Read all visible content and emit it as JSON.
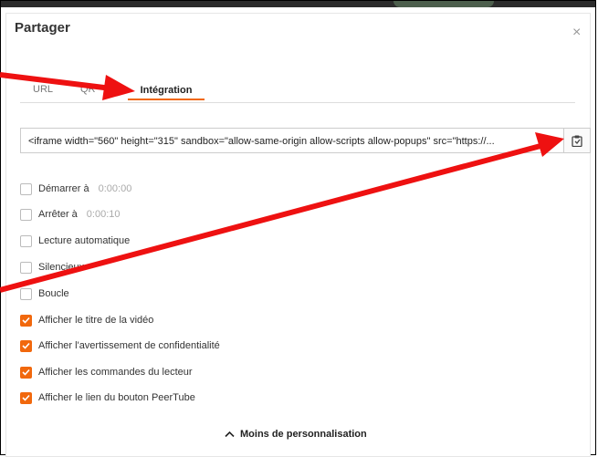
{
  "dialog": {
    "title": "Partager",
    "close_glyph": "×"
  },
  "tabs": [
    {
      "label": "URL"
    },
    {
      "label": "QR"
    },
    {
      "label": "Intégration"
    }
  ],
  "embed": {
    "code": "<iframe width=\"560\" height=\"315\" sandbox=\"allow-same-origin allow-scripts allow-popups\" src=\"https://...",
    "copy_icon": "clipboard-icon"
  },
  "options": [
    {
      "label": "Démarrer à",
      "time": "0:00:00",
      "checked": false
    },
    {
      "label": "Arrêter à",
      "time": "0:00:10",
      "checked": false
    },
    {
      "label": "Lecture automatique",
      "checked": false
    },
    {
      "label": "Silencieux",
      "checked": false
    },
    {
      "label": "Boucle",
      "checked": false
    },
    {
      "label": "Afficher le titre de la vidéo",
      "checked": true
    },
    {
      "label": "Afficher l'avertissement de confidentialité",
      "checked": true
    },
    {
      "label": "Afficher les commandes du lecteur",
      "checked": true
    },
    {
      "label": "Afficher le lien du bouton PeerTube",
      "checked": true
    }
  ],
  "footer": {
    "less_label": "Moins de personnalisation",
    "less_icon": "chevron-up-icon"
  },
  "colors": {
    "accent": "#f1680d",
    "annotation_arrow": "#ee1111"
  }
}
